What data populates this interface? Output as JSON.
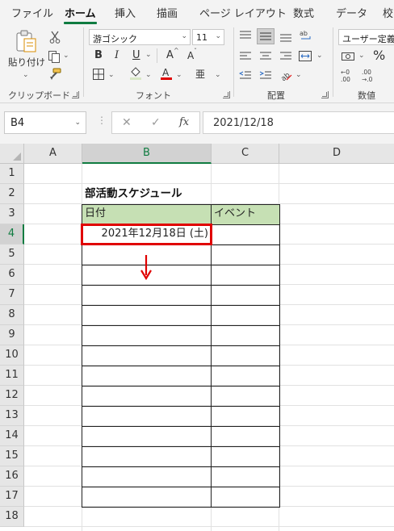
{
  "ribbon": {
    "tabs": [
      "ファイル",
      "ホーム",
      "挿入",
      "描画",
      "ページ レイアウト",
      "数式",
      "データ",
      "校"
    ],
    "active_tab": "ホーム",
    "clipboard": {
      "paste_label": "貼り付け",
      "group_label": "クリップボード"
    },
    "font": {
      "name": "游ゴシック",
      "size": "11",
      "bold": "B",
      "italic": "I",
      "underline": "U",
      "grow": "A",
      "shrink": "A",
      "phonetic": "亜",
      "group_label": "フォント"
    },
    "alignment": {
      "group_label": "配置"
    },
    "number": {
      "format": "ユーザー定義",
      "percent": "%",
      "group_label": "数値"
    }
  },
  "formula_bar": {
    "name_box": "B4",
    "fx": "fx",
    "formula": "2021/12/18"
  },
  "sheet": {
    "columns": [
      "A",
      "B",
      "C",
      "D"
    ],
    "selected_column": "B",
    "rows": [
      "1",
      "2",
      "3",
      "4",
      "5",
      "6",
      "7",
      "8",
      "9",
      "10",
      "11",
      "12",
      "13",
      "14",
      "15",
      "16",
      "17",
      "18"
    ],
    "selected_row": "4",
    "title": "部活動スケジュール",
    "headers": {
      "date": "日付",
      "event": "イベント"
    },
    "b4_value": "2021年12月18日 (土)"
  },
  "colors": {
    "accent": "#107c41",
    "header_fill": "#c6e0b4",
    "highlight": "#e00000"
  }
}
